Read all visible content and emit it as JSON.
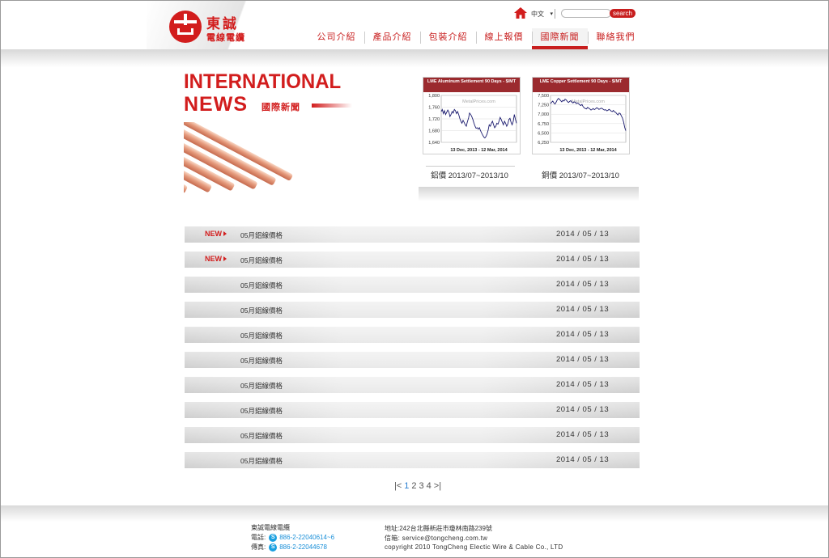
{
  "header": {
    "logo_name": "東誠",
    "logo_sub": "電線電纜",
    "lang": "中文",
    "search_label": "search",
    "nav": [
      {
        "label": "公司介紹"
      },
      {
        "label": "產品介紹"
      },
      {
        "label": "包裝介紹"
      },
      {
        "label": "線上報價"
      },
      {
        "label": "國際新聞",
        "active": true
      },
      {
        "label": "聯絡我們"
      }
    ]
  },
  "hero": {
    "title_line1": "INTERNATIONAL",
    "title_line2": "NEWS",
    "subtitle": "國際新聞"
  },
  "charts": [
    {
      "head": "LME Aluminum Settlement 90 Days - $/MT",
      "watermark": "MetalPrices.com",
      "range_label": "13 Dec, 2013 - 12 Mar, 2014",
      "caption": "鋁價 2013/07~2013/10"
    },
    {
      "head": "LME Copper Settlement 90 Days - $/MT",
      "watermark": "MetalPrices.com",
      "range_label": "13 Dec, 2013 - 12 Mar, 2014",
      "caption": "銅價 2013/07~2013/10"
    }
  ],
  "chart_data": [
    {
      "type": "line",
      "title": "LME Aluminum Settlement 90 Days - $/MT",
      "xlabel": "13 Dec, 2013 - 12 Mar, 2014",
      "ylim": [
        1640,
        1800
      ],
      "yticks": [
        "1,800",
        "1,760",
        "1,720",
        "1,680",
        "1,640"
      ],
      "color": "#1a1a6e",
      "values": [
        1745,
        1752,
        1738,
        1748,
        1735,
        1742,
        1750,
        1744,
        1728,
        1735,
        1745,
        1740,
        1752,
        1748,
        1738,
        1745,
        1735,
        1722,
        1712,
        1705,
        1715,
        1708,
        1700,
        1695,
        1710,
        1722,
        1740,
        1735,
        1728,
        1718,
        1706,
        1695,
        1688,
        1690,
        1685,
        1690,
        1680,
        1672,
        1665,
        1658,
        1655,
        1660,
        1668,
        1682,
        1700,
        1695,
        1705,
        1712,
        1700,
        1690,
        1695,
        1705,
        1702,
        1712,
        1725,
        1718,
        1708,
        1700,
        1712,
        1705,
        1695,
        1702,
        1718,
        1722,
        1708,
        1700,
        1712,
        1735,
        1718,
        1705
      ]
    },
    {
      "type": "line",
      "title": "LME Copper Settlement 90 Days - $/MT",
      "xlabel": "13 Dec, 2013 - 12 Mar, 2014",
      "ylim": [
        6250,
        7500
      ],
      "yticks": [
        "7,500",
        "7,250",
        "7,000",
        "6,750",
        "6,500",
        "6,250"
      ],
      "color": "#1a1a6e",
      "values": [
        7280,
        7320,
        7350,
        7300,
        7270,
        7320,
        7380,
        7420,
        7400,
        7360,
        7330,
        7370,
        7350,
        7400,
        7380,
        7340,
        7310,
        7340,
        7360,
        7320,
        7300,
        7330,
        7320,
        7280,
        7300,
        7280,
        7250,
        7230,
        7260,
        7200,
        7170,
        7150,
        7140,
        7180,
        7160,
        7140,
        7110,
        7130,
        7150,
        7120,
        7140,
        7170,
        7160,
        7130,
        7140,
        7160,
        7150,
        7130,
        7110,
        7120,
        7090,
        7100,
        7130,
        7110,
        7080,
        7070,
        7100,
        7060,
        7050,
        7010,
        6980,
        7030,
        7020,
        6960,
        6900,
        6800,
        6650,
        6560
      ]
    }
  ],
  "news": [
    {
      "is_new": true,
      "badge": "NEW",
      "title": "05月鋁線價格",
      "date": "2014 / 05 / 13"
    },
    {
      "is_new": true,
      "badge": "NEW",
      "title": "05月鋁線價格",
      "date": "2014 / 05 / 13"
    },
    {
      "is_new": false,
      "badge": "",
      "title": "05月鋁線價格",
      "date": "2014 / 05 / 13"
    },
    {
      "is_new": false,
      "badge": "",
      "title": "05月鋁線價格",
      "date": "2014 / 05 / 13"
    },
    {
      "is_new": false,
      "badge": "",
      "title": "05月鋁線價格",
      "date": "2014 / 05 / 13"
    },
    {
      "is_new": false,
      "badge": "",
      "title": "05月鋁線價格",
      "date": "2014 / 05 / 13"
    },
    {
      "is_new": false,
      "badge": "",
      "title": "05月鋁線價格",
      "date": "2014 / 05 / 13"
    },
    {
      "is_new": false,
      "badge": "",
      "title": "05月鋁線價格",
      "date": "2014 / 05 / 13"
    },
    {
      "is_new": false,
      "badge": "",
      "title": "05月鋁線價格",
      "date": "2014 / 05 / 13"
    },
    {
      "is_new": false,
      "badge": "",
      "title": "05月鋁線價格",
      "date": "2014 / 05 / 13"
    }
  ],
  "pager": {
    "prev": "|<",
    "pages": [
      "1",
      "2",
      "3",
      "4"
    ],
    "active": "1",
    "next": ">|"
  },
  "footer": {
    "company": "東誠電線電纜",
    "phone_label": "電話:",
    "phone": "886-2-22040614~6",
    "fax_label": "傳真:",
    "fax": "886-2-22044678",
    "address": "地址:242台北縣新莊市瓊林南路239號",
    "email": "信箱: service@tongcheng.com.tw",
    "copyright": "copyright 2010 TongCheng Electic Wire & Cable Co., LTD"
  },
  "colors": {
    "brand_red": "#d21d1d",
    "link_blue": "#1a8fd8",
    "chart_head": "#9b2a2e",
    "chart_line": "#1a1a6e"
  }
}
